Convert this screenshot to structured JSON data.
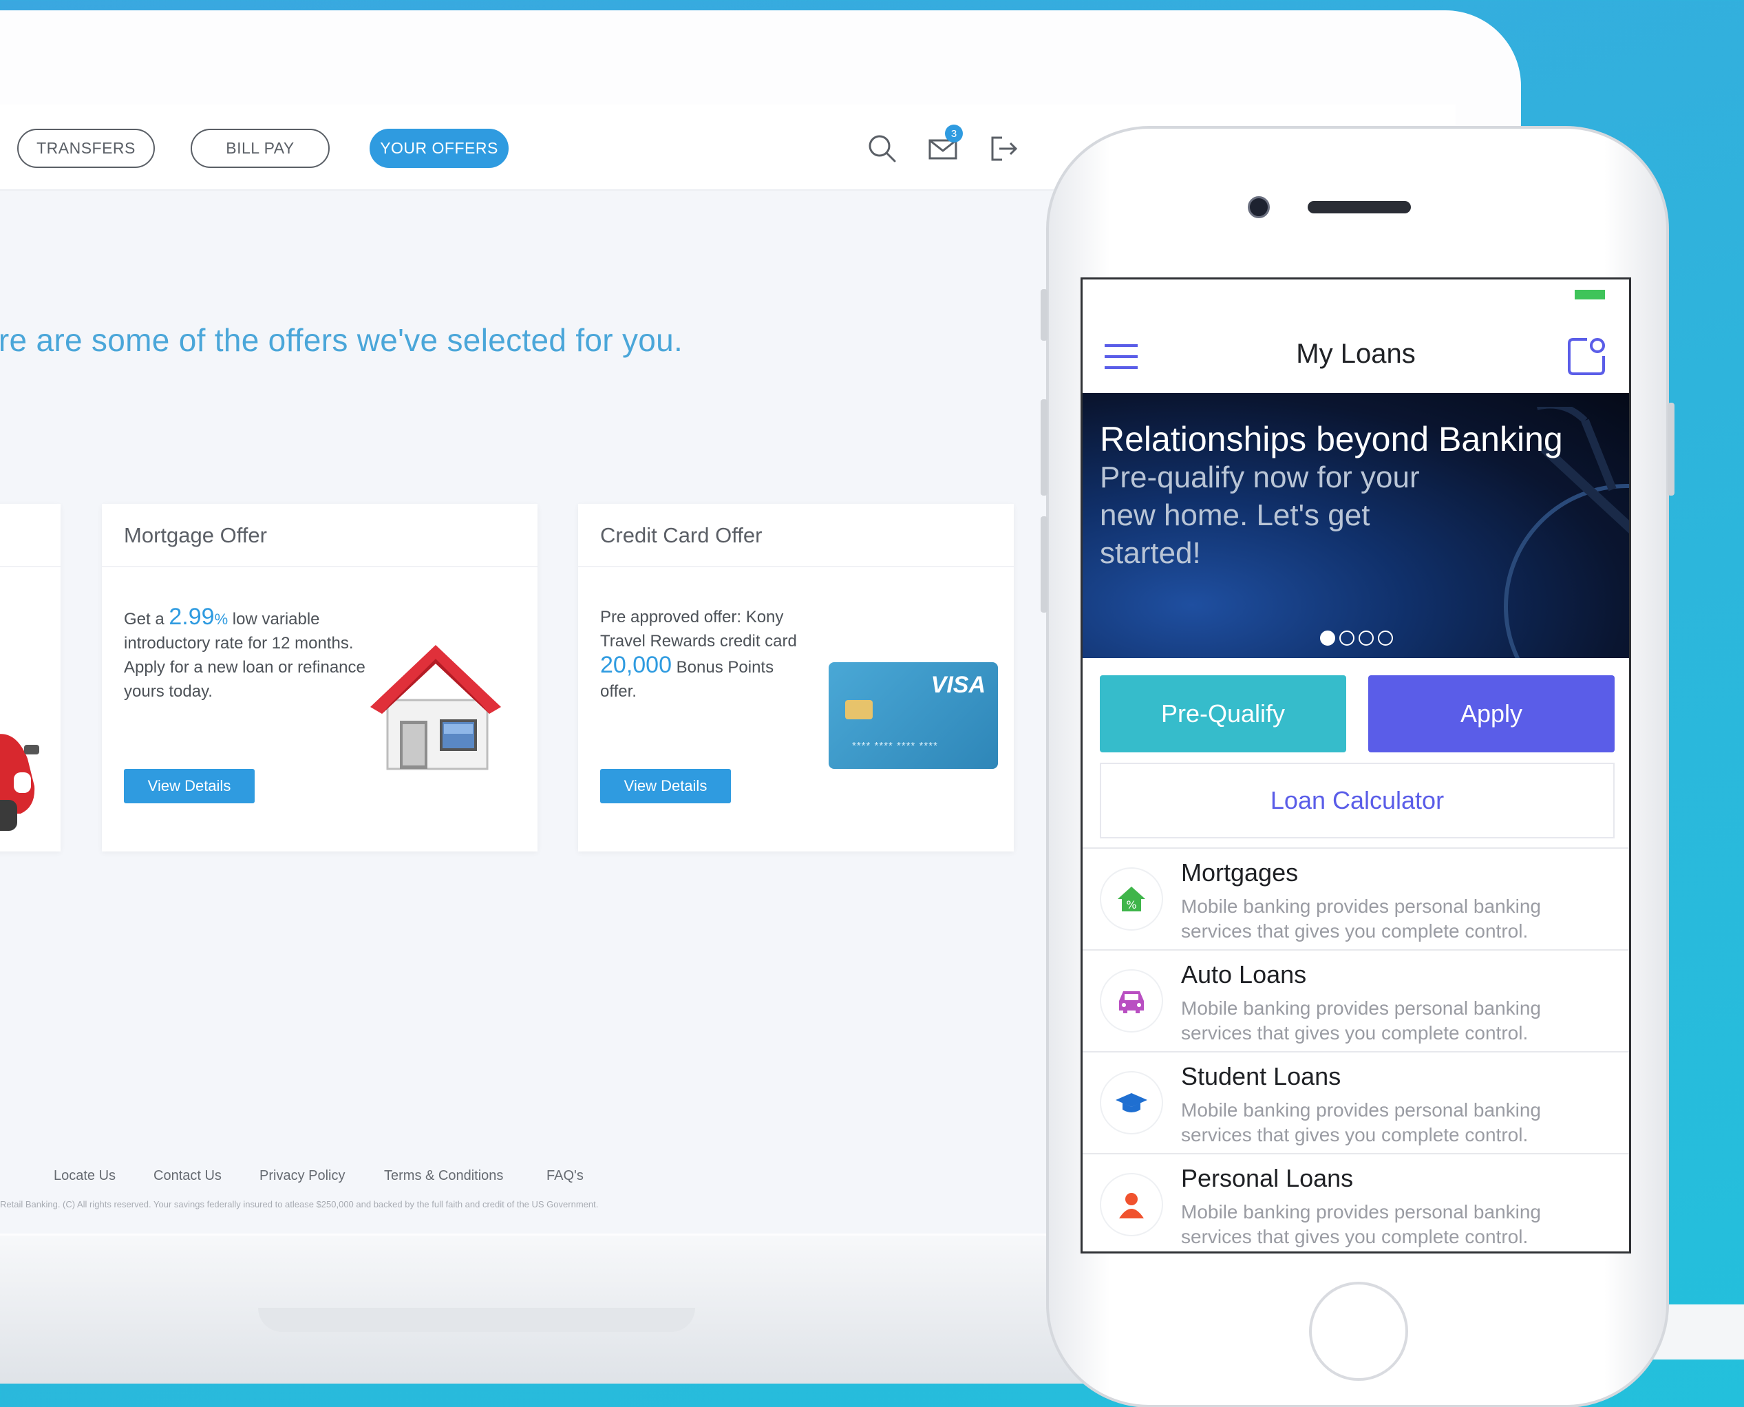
{
  "browser": {
    "nav": {
      "transfers": "TRANSFERS",
      "bill_pay": "BILL PAY",
      "your_offers": "YOUR OFFERS"
    },
    "mail_badge": "3",
    "headline": "ere are some of the offers we've selected for you.",
    "offers": [
      {
        "title": "Mortgage Offer",
        "text_pre": "Get a ",
        "rate": "2.99",
        "rate_unit": "%",
        "text_post": " low variable introductory rate for 12 months. Apply for a new loan or refinance yours today.",
        "button": "View Details"
      },
      {
        "title": "Credit Card Offer",
        "text_pre": "Pre approved offer: Kony Travel Rewards credit card ",
        "points": "20,000",
        "text_post": " Bonus Points offer.",
        "button": "View Details",
        "card_brand": "VISA",
        "card_number": "**** **** **** ****"
      }
    ],
    "footer": {
      "links": [
        "Locate Us",
        "Contact Us",
        "Privacy Policy",
        "Terms & Conditions",
        "FAQ's"
      ],
      "copyright": "Retail Banking. (C) All rights reserved.  Your savings federally insured to atlease $250,000 and backed by the full faith and credit of the US Government."
    },
    "colors": {
      "accent": "#2f9be0",
      "headline": "#4aa6d9"
    }
  },
  "phone": {
    "title": "My Loans",
    "banner": {
      "title": "Relationships beyond Banking",
      "subtitle": "Pre-qualify now for your new home.  Let's get started!"
    },
    "buttons": {
      "prequalify": "Pre-Qualify",
      "apply": "Apply",
      "calculator": "Loan Calculator"
    },
    "loans": [
      {
        "title": "Mortgages",
        "desc": "Mobile banking provides personal banking services that gives you complete control.",
        "icon": "house-percent-icon"
      },
      {
        "title": "Auto Loans",
        "desc": "Mobile banking provides personal banking services that gives you complete control.",
        "icon": "car-icon"
      },
      {
        "title": "Student Loans",
        "desc": "Mobile banking provides personal banking services that gives you complete control.",
        "icon": "graduation-cap-icon"
      },
      {
        "title": "Personal Loans",
        "desc": "Mobile banking provides personal banking services that gives you complete control.",
        "icon": "person-icon"
      }
    ],
    "colors": {
      "prequalify": "#36bccb",
      "apply": "#5a5de8",
      "battery": "#3fc45a"
    }
  }
}
